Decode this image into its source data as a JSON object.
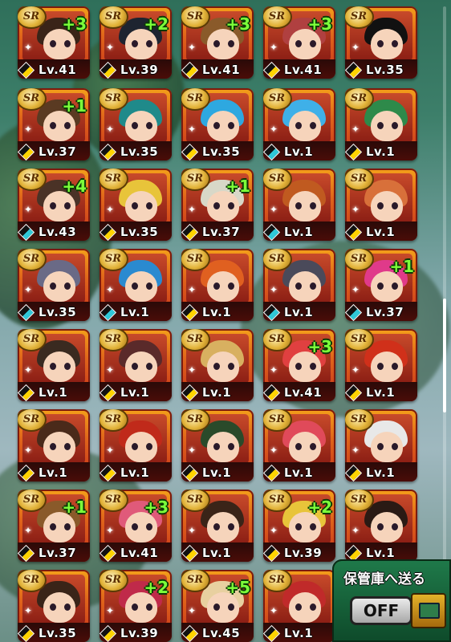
{
  "grid": {
    "rows": [
      [
        {
          "lv": "Lv.41",
          "plus": "+3",
          "hair": "#3a2418",
          "gem": "yellow"
        },
        {
          "lv": "Lv.39",
          "plus": "+2",
          "hair": "#1e2430",
          "gem": "yellow"
        },
        {
          "lv": "Lv.41",
          "plus": "+3",
          "hair": "#8a5a2a",
          "gem": "yellow"
        },
        {
          "lv": "Lv.41",
          "plus": "+3",
          "hair": "#b04040",
          "gem": "yellow"
        },
        {
          "lv": "Lv.35",
          "plus": "",
          "hair": "#111111",
          "gem": "yellow"
        }
      ],
      [
        {
          "lv": "Lv.37",
          "plus": "+1",
          "hair": "#5a3a22",
          "gem": "yellow"
        },
        {
          "lv": "Lv.35",
          "plus": "",
          "hair": "#1f8a8a",
          "gem": "yellow"
        },
        {
          "lv": "Lv.35",
          "plus": "",
          "hair": "#2ea8e0",
          "gem": "yellow"
        },
        {
          "lv": "Lv.1",
          "plus": "",
          "hair": "#3fb0e8",
          "gem": "blue"
        },
        {
          "lv": "Lv.1",
          "plus": "",
          "hair": "#2e8a4a",
          "gem": "yellow"
        }
      ],
      [
        {
          "lv": "Lv.43",
          "plus": "+4",
          "hair": "#4a3226",
          "gem": "blue"
        },
        {
          "lv": "Lv.35",
          "plus": "",
          "hair": "#e8c43a",
          "gem": "yellow"
        },
        {
          "lv": "Lv.37",
          "plus": "+1",
          "hair": "#d8d8c8",
          "gem": "yellow"
        },
        {
          "lv": "Lv.1",
          "plus": "",
          "hair": "#c05a20",
          "gem": "blue"
        },
        {
          "lv": "Lv.1",
          "plus": "",
          "hair": "#d8703a",
          "gem": "yellow"
        }
      ],
      [
        {
          "lv": "Lv.35",
          "plus": "",
          "hair": "#6a6a86",
          "gem": "blue"
        },
        {
          "lv": "Lv.1",
          "plus": "",
          "hair": "#2a8ad0",
          "gem": "blue"
        },
        {
          "lv": "Lv.1",
          "plus": "",
          "hair": "#e06020",
          "gem": "yellow"
        },
        {
          "lv": "Lv.1",
          "plus": "",
          "hair": "#4a4a5a",
          "gem": "blue"
        },
        {
          "lv": "Lv.37",
          "plus": "+1",
          "hair": "#e03a8a",
          "gem": "blue"
        }
      ],
      [
        {
          "lv": "Lv.1",
          "plus": "",
          "hair": "#3a2a20",
          "gem": "yellow"
        },
        {
          "lv": "Lv.1",
          "plus": "",
          "hair": "#5a2a2a",
          "gem": "yellow"
        },
        {
          "lv": "Lv.1",
          "plus": "",
          "hair": "#d8b060",
          "gem": "yellow"
        },
        {
          "lv": "Lv.41",
          "plus": "+3",
          "hair": "#e04040",
          "gem": "yellow"
        },
        {
          "lv": "Lv.1",
          "plus": "",
          "hair": "#d0301a",
          "gem": "yellow"
        }
      ],
      [
        {
          "lv": "Lv.1",
          "plus": "",
          "hair": "#4a2a1a",
          "gem": "yellow"
        },
        {
          "lv": "Lv.1",
          "plus": "",
          "hair": "#c02a1a",
          "gem": "yellow"
        },
        {
          "lv": "Lv.1",
          "plus": "",
          "hair": "#2a4a2a",
          "gem": "yellow"
        },
        {
          "lv": "Lv.1",
          "plus": "",
          "hair": "#e04a5a",
          "gem": "yellow"
        },
        {
          "lv": "Lv.1",
          "plus": "",
          "hair": "#e8e8e8",
          "gem": "yellow"
        }
      ],
      [
        {
          "lv": "Lv.37",
          "plus": "+1",
          "hair": "#8a5a2a",
          "gem": "yellow"
        },
        {
          "lv": "Lv.41",
          "plus": "+3",
          "hair": "#e05a7a",
          "gem": "yellow"
        },
        {
          "lv": "Lv.1",
          "plus": "",
          "hair": "#3a2418",
          "gem": "yellow"
        },
        {
          "lv": "Lv.39",
          "plus": "+2",
          "hair": "#e8c43a",
          "gem": "yellow"
        },
        {
          "lv": "Lv.1",
          "plus": "",
          "hair": "#2a1a14",
          "gem": "yellow"
        }
      ],
      [
        {
          "lv": "Lv.35",
          "plus": "",
          "hair": "#3a2418",
          "gem": "yellow"
        },
        {
          "lv": "Lv.39",
          "plus": "+2",
          "hair": "#c02a4a",
          "gem": "yellow"
        },
        {
          "lv": "Lv.45",
          "plus": "+5",
          "hair": "#e8d0a0",
          "gem": "yellow"
        },
        {
          "lv": "Lv.1",
          "plus": "",
          "hair": "#c02a2a",
          "gem": "yellow"
        }
      ]
    ],
    "rarity_label": "SR"
  },
  "storage_panel": {
    "label": "保管庫へ送る",
    "toggle": "OFF",
    "icon": "storage-chest-icon"
  },
  "colors": {
    "plus_badge": "#7cff3a",
    "card_frame": "#e0661a"
  }
}
